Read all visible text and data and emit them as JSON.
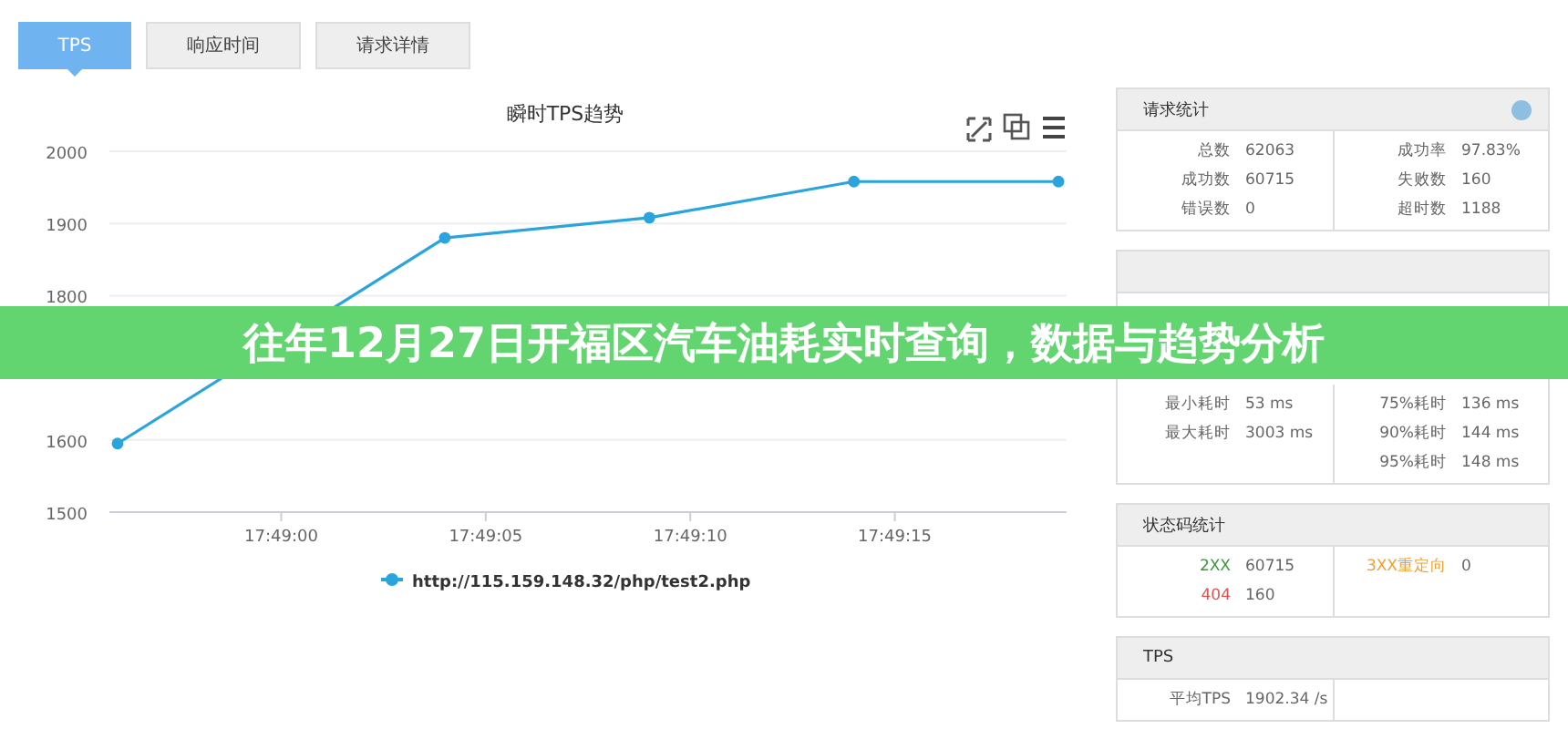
{
  "tabs": [
    {
      "label": "TPS",
      "selected": true
    },
    {
      "label": "响应时间",
      "selected": false
    },
    {
      "label": "请求详情",
      "selected": false
    }
  ],
  "chart": {
    "chart_data": {
      "type": "line",
      "title": "瞬时TPS趋势",
      "grid": true,
      "x": [
        64136,
        64144,
        64149,
        64154,
        64159
      ],
      "xlim": [
        64135.8,
        64159.2
      ],
      "ylim": [
        1500,
        2000
      ],
      "xticks": [
        {
          "value": 64140,
          "label": "17:49:00"
        },
        {
          "value": 64145,
          "label": "17:49:05"
        },
        {
          "value": 64150,
          "label": "17:49:10"
        },
        {
          "value": 64155,
          "label": "17:49:15"
        }
      ],
      "yticks": [
        1500,
        1600,
        1800,
        1900,
        2000
      ],
      "series": [
        {
          "name": "http://115.159.148.32/php/test2.php",
          "color": "#2aa4dc",
          "marker": "circle",
          "values": [
            1595,
            1880,
            1908,
            1958,
            1958
          ]
        }
      ]
    }
  },
  "panels": [
    {
      "title": "请求统计",
      "help": true,
      "left": [
        {
          "label": "总数",
          "value": "62063"
        },
        {
          "label": "成功数",
          "value": "60715"
        },
        {
          "label": "错误数",
          "value": "0"
        }
      ],
      "right": [
        {
          "label": "成功率",
          "value": "97.83%"
        },
        {
          "label": "失败数",
          "value": "160"
        },
        {
          "label": "超时数",
          "value": "1188"
        }
      ]
    },
    {
      "help": false,
      "left": [
        {
          "label": "最小耗时",
          "value": "53 ms"
        },
        {
          "label": "最大耗时",
          "value": "3003 ms"
        }
      ],
      "right": [
        {
          "label": "75%耗时",
          "value": "136 ms"
        },
        {
          "label": "90%耗时",
          "value": "144 ms"
        },
        {
          "label": "95%耗时",
          "value": "148 ms"
        }
      ]
    },
    {
      "title": "状态码统计",
      "help": false,
      "left": [
        {
          "label": "2XX",
          "value": "60715",
          "color": "#3a9a3a"
        },
        {
          "label": "404",
          "value": "160",
          "color": "#d9534f"
        }
      ],
      "right": [
        {
          "label": "3XX重定向",
          "value": "0",
          "color": "#f0a030"
        }
      ]
    },
    {
      "title": "TPS",
      "help": false,
      "left": [
        {
          "label": "平均TPS",
          "value": "1902.34 /s"
        }
      ]
    }
  ],
  "banner": {
    "text": "往年12月27日开福区汽车油耗实时查询，数据与趋势分析"
  }
}
